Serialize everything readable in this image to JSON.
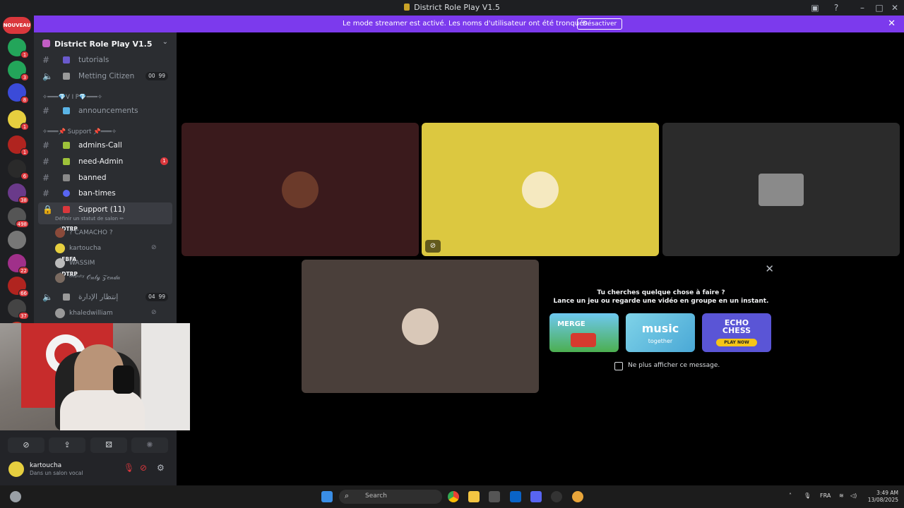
{
  "window": {
    "title": "District Role Play V1.5",
    "controls": [
      "minimize-icon",
      "maximize-icon",
      "close-icon"
    ]
  },
  "banner": {
    "message": "Le mode streamer est activé. Les noms d'utilisateur ont été tronqués.",
    "button": "Désactiver"
  },
  "rail": {
    "new_label": "NOUVEAU",
    "servers": [
      {
        "badge": "1",
        "color": "#23a55a"
      },
      {
        "badge": "3",
        "color": "#23a55a"
      },
      {
        "badge": "8",
        "color": "#3b4bd8"
      },
      {
        "badge": "1",
        "color": "#e6cf3f"
      },
      {
        "badge": "1",
        "color": "#b0241f"
      },
      {
        "badge": "6",
        "color": "#2a2a2a"
      },
      {
        "badge": "38",
        "color": "#6a3a8a"
      },
      {
        "badge": "498",
        "color": "#555555"
      },
      {
        "badge": "",
        "color": "#777777"
      },
      {
        "badge": "22",
        "color": "#a0308a"
      },
      {
        "badge": "66",
        "color": "#b0241f"
      },
      {
        "badge": "37",
        "color": "#444444"
      },
      {
        "badge": "",
        "color": "#c0392b"
      }
    ]
  },
  "sidebar": {
    "server_name": "District Role Play V1.5",
    "channels": {
      "tutorials": "tutorials",
      "metting": "Metting Citizen",
      "metting_count": "00",
      "metting_limit": "99",
      "vip_category": "✧═══💎V I P💎═══✧",
      "announcements": "announcements",
      "support_category": "✧═══📌 Support 📌═══✧",
      "admins_call": "admins-Call",
      "need_admin": "need-Admin",
      "need_admin_badge": "1",
      "banned": "banned",
      "ban_times": "ban-times",
      "support_voice": "Support (11)",
      "support_status": "Définir un statut de salon ✏",
      "arabic_voice": "إنتظار الإدارة",
      "arabic_count": "04",
      "arabic_limit": "99"
    },
    "members": [
      {
        "name": "? CAMACHO ?",
        "tag": "⚡DTRP",
        "color": "#8a4a3a"
      },
      {
        "name": "kartoucha",
        "tag": "",
        "color": "#e6cf3f"
      },
      {
        "name": "WASSIM",
        "tag": "⚡FBFA",
        "color": "#bbbbbb"
      },
      {
        "name": "ᴰᵉᵖᵘᵗʸ 𝒪𝓃𝓁𝓎 𝒵𝑒𝓃𝒹𝒶",
        "tag": "⚡DTRP",
        "color": "#7a6a60"
      },
      {
        "name": "khaledwilliam",
        "tag": "",
        "color": "#999999"
      }
    ]
  },
  "voice_panel": {
    "buttons": [
      "camera-off-icon",
      "screen-share-icon",
      "activity-icon",
      "soundboard-icon"
    ],
    "user_name": "kartoucha",
    "user_status": "Dans un salon vocal"
  },
  "stage": {
    "tiles": [
      {
        "bg": "#3a1a1c",
        "avatar": "#6b3a2a"
      },
      {
        "bg": "#dcc840",
        "avatar": "#f5e9c0"
      },
      {
        "bg": "#2b2b2b",
        "avatar": "#8a8a8a"
      },
      {
        "bg": "#4a3f3a",
        "avatar": "#d9c8b8"
      }
    ],
    "activity": {
      "line1": "Tu cherches quelque chose à faire ?",
      "line2": "Lance un jeu ou regarde une vidéo en groupe en un instant.",
      "games": [
        {
          "label": "MERGE",
          "bg": "#4fb5e6"
        },
        {
          "label": "music",
          "bg": "#57b8d8"
        },
        {
          "label": "ECHO CHESS",
          "bg": "#5a55d6"
        }
      ],
      "sub": "together",
      "play": "PLAY NOW",
      "checkbox_label": "Ne plus afficher ce message."
    }
  },
  "taskbar": {
    "search_placeholder": "Search",
    "language": "FRA",
    "time": "3:49 AM",
    "date": "13/08/2025"
  }
}
